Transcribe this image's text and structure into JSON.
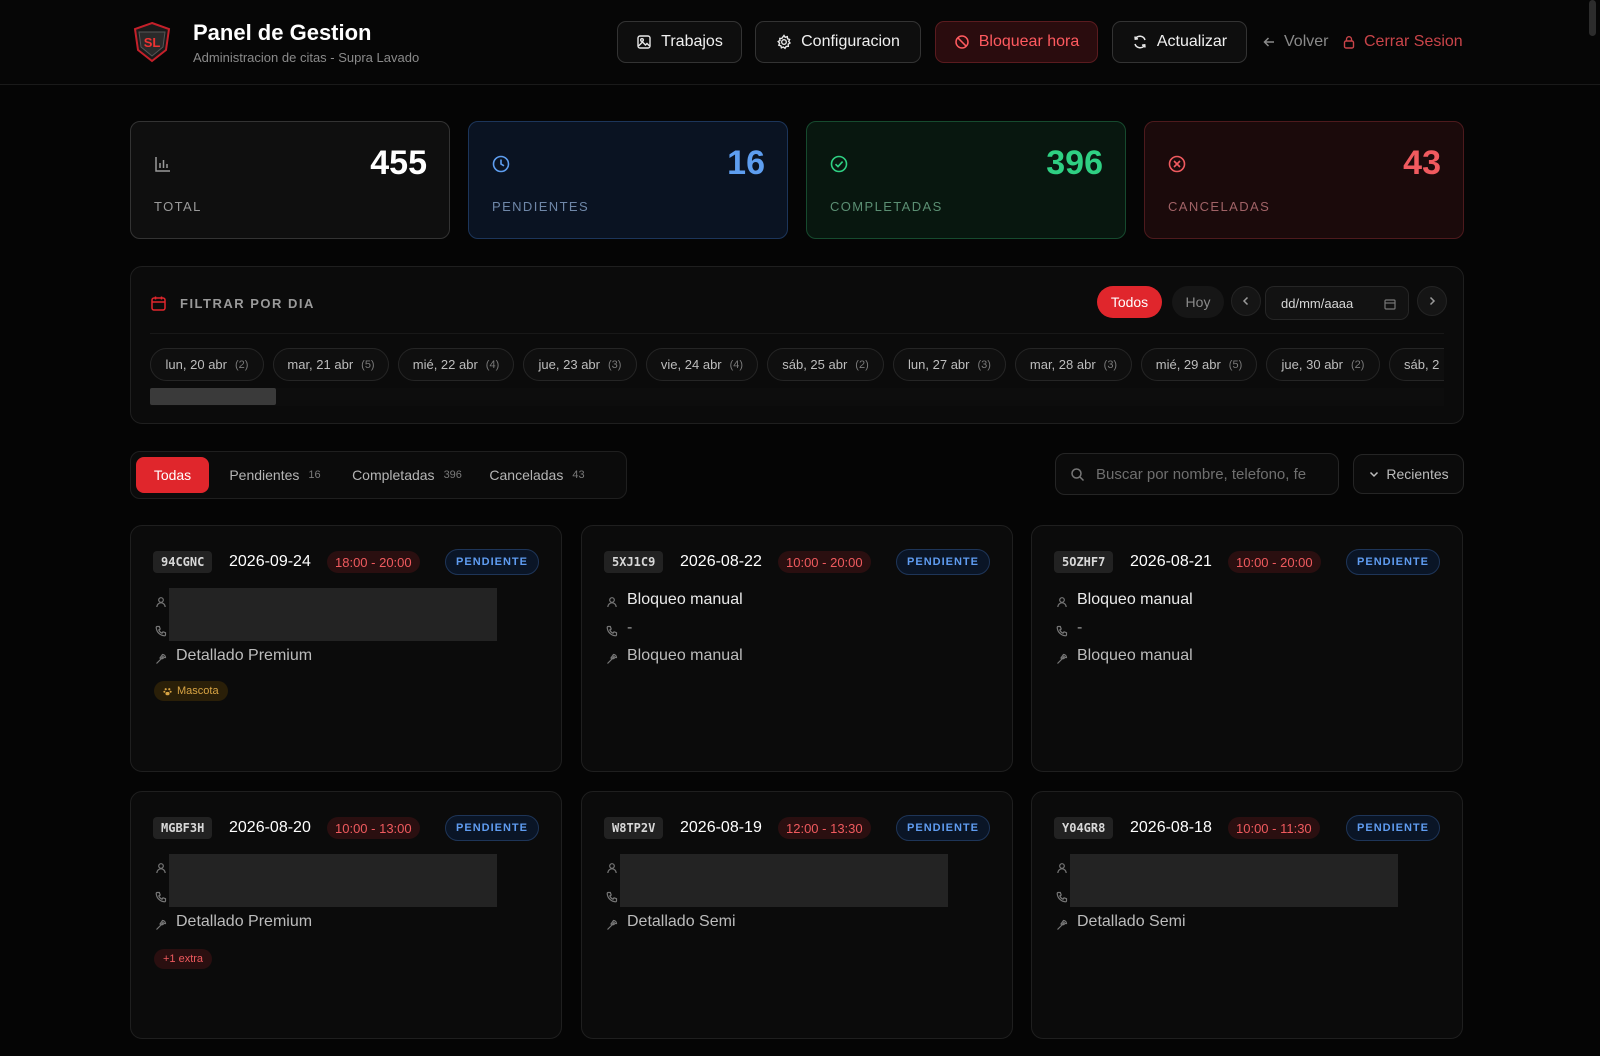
{
  "header": {
    "title": "Panel de Gestion",
    "subtitle": "Administracion de citas - Supra Lavado",
    "logo_text": "SL",
    "buttons": {
      "trabajos": "Trabajos",
      "configuracion": "Configuracion",
      "bloquear": "Bloquear hora",
      "actualizar": "Actualizar"
    },
    "links": {
      "volver": "Volver",
      "cerrar": "Cerrar Sesion"
    }
  },
  "stats": {
    "total": {
      "value": "455",
      "label": "TOTAL"
    },
    "pendientes": {
      "value": "16",
      "label": "PENDIENTES"
    },
    "completadas": {
      "value": "396",
      "label": "COMPLETADAS"
    },
    "canceladas": {
      "value": "43",
      "label": "CANCELADAS"
    }
  },
  "filter": {
    "title": "FILTRAR POR DIA",
    "todos": "Todos",
    "hoy": "Hoy",
    "date_placeholder": "dd/mm/aaaa",
    "days": [
      {
        "label": "lun, 20 abr",
        "count": "(2)"
      },
      {
        "label": "mar, 21 abr",
        "count": "(5)"
      },
      {
        "label": "mié, 22 abr",
        "count": "(4)"
      },
      {
        "label": "jue, 23 abr",
        "count": "(3)"
      },
      {
        "label": "vie, 24 abr",
        "count": "(4)"
      },
      {
        "label": "sáb, 25 abr",
        "count": "(2)"
      },
      {
        "label": "lun, 27 abr",
        "count": "(3)"
      },
      {
        "label": "mar, 28 abr",
        "count": "(3)"
      },
      {
        "label": "mié, 29 abr",
        "count": "(5)"
      },
      {
        "label": "jue, 30 abr",
        "count": "(2)"
      },
      {
        "label": "sáb, 2",
        "count": ""
      }
    ]
  },
  "tabs": {
    "todas": "Todas",
    "pendientes": {
      "label": "Pendientes",
      "count": "16"
    },
    "completadas": {
      "label": "Completadas",
      "count": "396"
    },
    "canceladas": {
      "label": "Canceladas",
      "count": "43"
    }
  },
  "search": {
    "placeholder": "Buscar por nombre, telefono, fe"
  },
  "sort": {
    "label": "Recientes"
  },
  "appointments": [
    {
      "code": "94CGNC",
      "date": "2026-09-24",
      "time": "18:00 - 20:00",
      "status": "PENDIENTE",
      "service": "Detallado Premium",
      "tag": "Mascota"
    },
    {
      "code": "5XJ1C9",
      "date": "2026-08-22",
      "time": "10:00 - 20:00",
      "status": "PENDIENTE",
      "name": "Bloqueo manual",
      "phone": "-",
      "service": "Bloqueo manual"
    },
    {
      "code": "5OZHF7",
      "date": "2026-08-21",
      "time": "10:00 - 20:00",
      "status": "PENDIENTE",
      "name": "Bloqueo manual",
      "phone": "-",
      "service": "Bloqueo manual"
    },
    {
      "code": "MGBF3H",
      "date": "2026-08-20",
      "time": "10:00 - 13:00",
      "status": "PENDIENTE",
      "service": "Detallado Premium",
      "tag": "+1 extra"
    },
    {
      "code": "W8TP2V",
      "date": "2026-08-19",
      "time": "12:00 - 13:30",
      "status": "PENDIENTE",
      "service": "Detallado Semi"
    },
    {
      "code": "Y04GR8",
      "date": "2026-08-18",
      "time": "10:00 - 11:30",
      "status": "PENDIENTE",
      "service": "Detallado Semi"
    }
  ],
  "colors": {
    "accent_red": "#e0262c",
    "pending_blue": "#5e9ef0",
    "completed_green": "#2fd083",
    "canceled_red": "#f05a5f"
  }
}
